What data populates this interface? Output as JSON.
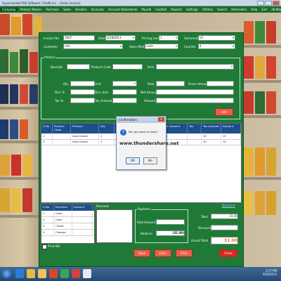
{
  "window": {
    "title": "Supermarket POS Software / ShaNi Inc. - [Sales Invoice]"
  },
  "menu": [
    "Company",
    "Product Master",
    "Purchase",
    "Sales",
    "Vendors",
    "Accounts",
    "Account Statements",
    "Payroll",
    "Cashbill",
    "Reports",
    "Settings",
    "Utilities",
    "Search",
    "Reminders",
    "Help",
    "Exit",
    "28-Mar-2013"
  ],
  "form": {
    "invoice_no_label": "Invoice No",
    "invoice_no": "1007",
    "date_label": "Date",
    "date": "3/18/2013",
    "pricing_level_label": "Pricing Level",
    "pricing_level": "1",
    "salesman_label": "Salesman",
    "salesman": "Vil",
    "customer_label": "Customer",
    "customer": "ram",
    "sales_mode_label": "Sales Mode",
    "sales_mode": "Cash",
    "counter_label": "Counter",
    "counter": "4",
    "product_section": "Product",
    "barcode_label": "Barcode",
    "product_code_label": "Product Code",
    "item_label": "Item",
    "qty_label": "Qty",
    "unit_label": "Unit",
    "rate_label": "Rate",
    "gross_amount_label": "Gross Amount",
    "disc_label": "Disc %",
    "discount_amount_label": "Disc Amt",
    "net_amount_label": "Net Amount",
    "tax_label": "Tax %",
    "tax_amount_label": "Tax Amount",
    "amount_label": "Amount",
    "add_button": "Add"
  },
  "grid": {
    "columns": [
      "S.No",
      "Product Code",
      "Product",
      "Qty",
      "Unit",
      "Rate",
      "Disc",
      "Net Amount",
      "Tax",
      "Tax Amount",
      "Amount"
    ],
    "rows": [
      [
        "1",
        "",
        "Auto Guard",
        "1",
        "",
        "",
        "",
        "15",
        "",
        "10",
        "15"
      ],
      [
        "2",
        "",
        "Auto Guard",
        "1",
        "",
        "",
        "",
        "",
        "",
        "10",
        "10"
      ]
    ]
  },
  "dialog": {
    "title": "Confirmation",
    "message": "Do you want to Save?",
    "watermark": "www.thundershare.net",
    "ok": "OK",
    "cancel": "No"
  },
  "lower": {
    "s_no_label": "S.No",
    "payment_label": "Payment",
    "amount_label": "Amount",
    "rows": [
      [
        "1",
        "Cash",
        ""
      ],
      [
        "2",
        "Card",
        ""
      ],
      [
        "3",
        "Credit",
        ""
      ],
      [
        "4",
        "Cheque",
        ""
      ]
    ],
    "remarks_label": "Remarks",
    "print_label": "Print Bill",
    "payment_section": "Payment",
    "paid_amount_label": "Paid Amount",
    "balance_label": "Balance",
    "balance": "(31.00)",
    "discount_link": "Discount",
    "total_label": "Total",
    "total": "31.00",
    "discount_label": "Discount",
    "grand_total_label": "Grand Total",
    "grand_total": "31.00",
    "btn_save": "Save",
    "btn_clear": "Clear",
    "btn_print": "Print",
    "btn_close": "Close"
  },
  "taskbar": {
    "time": "3:57 PM",
    "date": "3/18/2013"
  }
}
